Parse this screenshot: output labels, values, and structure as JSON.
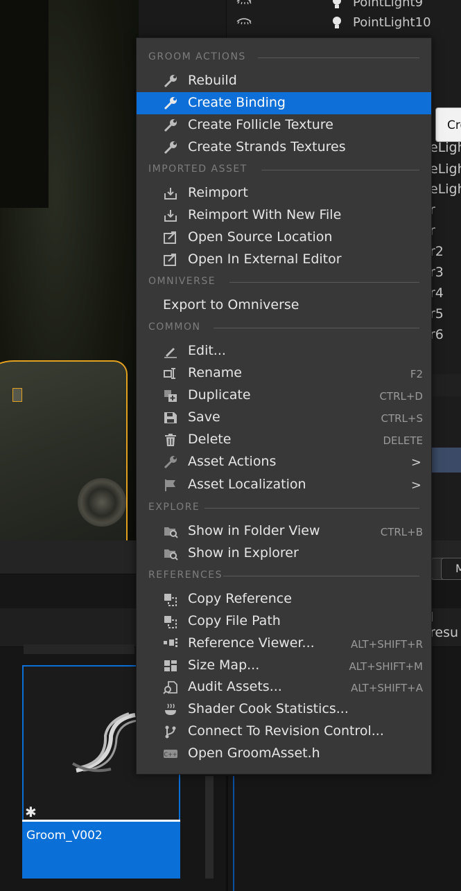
{
  "outliner": {
    "rows": [
      {
        "label": "PointLight9"
      },
      {
        "label": "PointLight10"
      }
    ],
    "peek_texts": [
      "eLigh",
      "eLigh",
      "eLigh",
      "r",
      "r",
      "r2",
      "r3",
      "r4",
      "r5",
      "r6"
    ],
    "peek_button": "Cre",
    "side_text": "l resu",
    "tab_text": "M"
  },
  "content_browser": {
    "asset_name": "Groom_V002"
  },
  "menu": {
    "sections": [
      {
        "label": "GROOM ACTIONS"
      },
      {
        "label": "IMPORTED ASSET"
      },
      {
        "label": "OMNIVERSE"
      },
      {
        "label": "COMMON"
      },
      {
        "label": "EXPLORE"
      },
      {
        "label": "REFERENCES"
      }
    ],
    "items": [
      {
        "label": "Rebuild",
        "icon": "wrench-icon",
        "shortcut": ""
      },
      {
        "label": "Create Binding",
        "icon": "wrench-icon",
        "shortcut": "",
        "highlighted": true
      },
      {
        "label": "Create Follicle Texture",
        "icon": "wrench-icon",
        "shortcut": ""
      },
      {
        "label": "Create Strands Textures",
        "icon": "wrench-icon",
        "shortcut": ""
      },
      {
        "label": "Reimport",
        "icon": "reimport-icon",
        "shortcut": ""
      },
      {
        "label": "Reimport With New File",
        "icon": "reimport-icon",
        "shortcut": ""
      },
      {
        "label": "Open Source Location",
        "icon": "open-location-icon",
        "shortcut": ""
      },
      {
        "label": "Open In External Editor",
        "icon": "external-editor-icon",
        "shortcut": ""
      },
      {
        "label": "Export to Omniverse",
        "icon": "",
        "shortcut": ""
      },
      {
        "label": "Edit...",
        "icon": "pencil-icon",
        "shortcut": ""
      },
      {
        "label": "Rename",
        "icon": "rename-icon",
        "shortcut": "F2"
      },
      {
        "label": "Duplicate",
        "icon": "duplicate-icon",
        "shortcut": "CTRL+D"
      },
      {
        "label": "Save",
        "icon": "save-icon",
        "shortcut": "CTRL+S"
      },
      {
        "label": "Delete",
        "icon": "trash-icon",
        "shortcut": "DELETE"
      },
      {
        "label": "Asset Actions",
        "icon": "wrench-icon",
        "shortcut": ""
      },
      {
        "label": "Asset Localization",
        "icon": "flag-icon",
        "shortcut": ""
      },
      {
        "label": "Show in Folder View",
        "icon": "folder-search-icon",
        "shortcut": "CTRL+B"
      },
      {
        "label": "Show in Explorer",
        "icon": "folder-search-icon",
        "shortcut": ""
      },
      {
        "label": "Copy Reference",
        "icon": "copy-icon",
        "shortcut": ""
      },
      {
        "label": "Copy File Path",
        "icon": "copy-icon",
        "shortcut": ""
      },
      {
        "label": "Reference Viewer...",
        "icon": "reference-viewer-icon",
        "shortcut": "ALT+SHIFT+R"
      },
      {
        "label": "Size Map...",
        "icon": "size-map-icon",
        "shortcut": "ALT+SHIFT+M"
      },
      {
        "label": "Audit Assets...",
        "icon": "audit-icon",
        "shortcut": "ALT+SHIFT+A"
      },
      {
        "label": "Shader Cook Statistics...",
        "icon": "shader-cook-icon",
        "shortcut": ""
      },
      {
        "label": "Connect To Revision Control...",
        "icon": "branch-icon",
        "shortcut": ""
      },
      {
        "label": "Open GroomAsset.h",
        "icon": "cpp-icon",
        "shortcut": ""
      }
    ],
    "submenu_glyph": ">"
  },
  "colors": {
    "highlight": "#0f6fd8",
    "menu_bg": "#383838",
    "selection": "#0b6fd8"
  }
}
